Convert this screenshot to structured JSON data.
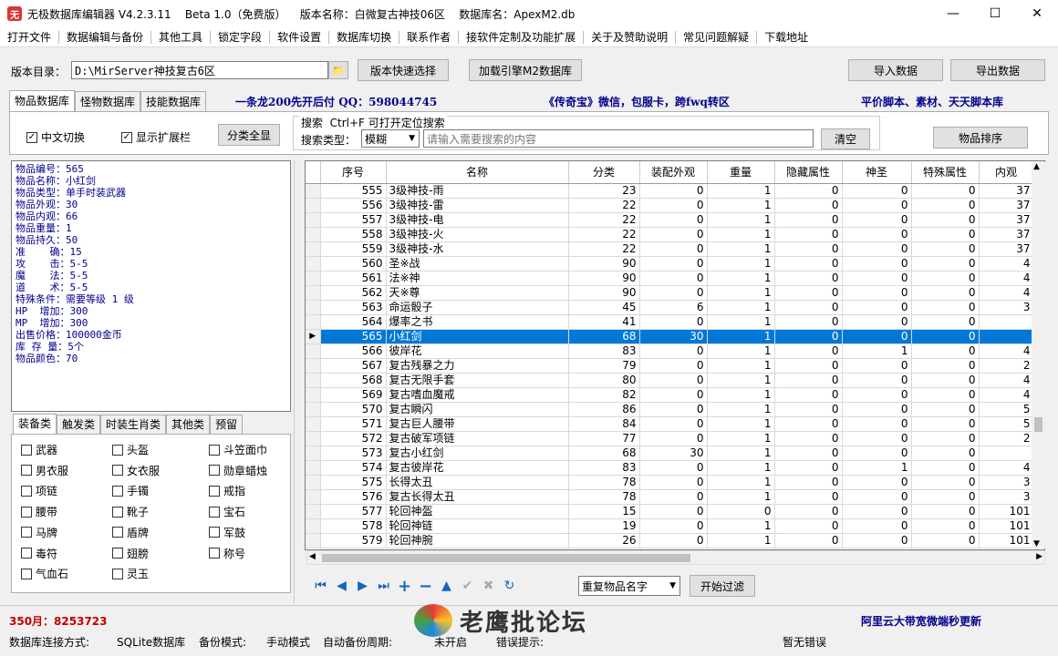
{
  "window": {
    "title": "无极数据库编辑器 V4.2.3.11    Beta 1.0（免费版）    版本名称：白微复古神技06区    数据库名：ApexM2.db",
    "minimize": "—",
    "maximize": "☐",
    "close": "✕"
  },
  "menu": [
    "打开文件",
    "数据编辑与备份",
    "其他工具",
    "锁定字段",
    "软件设置",
    "数据库切换",
    "联系作者",
    "接软件定制及功能扩展",
    "关于及赞助说明",
    "常见问题解疑",
    "下载地址"
  ],
  "toolbar": {
    "dir_label": "版本目录：",
    "dir_value": "D:\\MirServer神技复古6区",
    "quick_select": "版本快速选择",
    "load_engine": "加载引擎M2数据库",
    "import": "导入数据",
    "export": "导出数据"
  },
  "db_tabs": [
    "物品数据库",
    "怪物数据库",
    "技能数据库"
  ],
  "banners": {
    "b1": "一条龙200先开后付 QQ：598044745",
    "b2": "《传奇宝》微信，包服卡，跨fwq转区",
    "b3": "平价脚本、素材、天天脚本库"
  },
  "options": {
    "chinese_switch": "中文切换",
    "show_ext": "显示扩展栏",
    "show_all": "分类全显",
    "search_title": "搜索  Ctrl+F 可打开定位搜索",
    "search_type_label": "搜索类型：",
    "search_type_value": "模糊",
    "search_placeholder": "请输入需要搜索的内容",
    "clear": "清空",
    "sort": "物品排序"
  },
  "item_info": [
    "物品编号：565",
    "物品名称：小红剑",
    "物品类型：单手时装武器",
    "物品外观：30",
    "物品内观：66",
    "物品重量：1",
    "物品持久：50",
    "准    确：15",
    "攻    击：5-5",
    "魔    法：5-5",
    "道    术：5-5",
    "特殊条件：需要等级 1 级",
    "HP  增加：300",
    "MP  增加：300",
    "出售价格：100000金币",
    "库 存 量：5个",
    "物品颜色：70"
  ],
  "cat_tabs": [
    "装备类",
    "触发类",
    "时装生肖类",
    "其他类",
    "预留"
  ],
  "categories": [
    "武器",
    "头盔",
    "斗笠面巾",
    "男衣服",
    "女衣服",
    "勋章蜡烛",
    "项链",
    "手镯",
    "戒指",
    "腰带",
    "靴子",
    "宝石",
    "马牌",
    "盾牌",
    "军鼓",
    "毒符",
    "翅膀",
    "称号",
    "气血石",
    "灵玉"
  ],
  "table": {
    "headers": [
      "序号",
      "名称",
      "分类",
      "装配外观",
      "重量",
      "隐藏属性",
      "神圣",
      "特殊属性",
      "内观"
    ],
    "rows": [
      [
        "555",
        "3级神技-雨",
        "23",
        "0",
        "1",
        "0",
        "0",
        "0",
        "37"
      ],
      [
        "556",
        "3级神技-雷",
        "22",
        "0",
        "1",
        "0",
        "0",
        "0",
        "37"
      ],
      [
        "557",
        "3级神技-电",
        "22",
        "0",
        "1",
        "0",
        "0",
        "0",
        "37"
      ],
      [
        "558",
        "3级神技-火",
        "22",
        "0",
        "1",
        "0",
        "0",
        "0",
        "37"
      ],
      [
        "559",
        "3级神技-水",
        "22",
        "0",
        "1",
        "0",
        "0",
        "0",
        "37"
      ],
      [
        "560",
        "圣※战",
        "90",
        "0",
        "1",
        "0",
        "0",
        "0",
        "4"
      ],
      [
        "561",
        "法※神",
        "90",
        "0",
        "1",
        "0",
        "0",
        "0",
        "4"
      ],
      [
        "562",
        "天※尊",
        "90",
        "0",
        "1",
        "0",
        "0",
        "0",
        "4"
      ],
      [
        "563",
        "命运骰子",
        "45",
        "6",
        "1",
        "0",
        "0",
        "0",
        "3"
      ],
      [
        "564",
        "爆率之书",
        "41",
        "0",
        "1",
        "0",
        "0",
        "0",
        ""
      ],
      [
        "565",
        "小红剑",
        "68",
        "30",
        "1",
        "0",
        "0",
        "0",
        ""
      ],
      [
        "566",
        "彼岸花",
        "83",
        "0",
        "1",
        "0",
        "1",
        "0",
        "4"
      ],
      [
        "567",
        "复古残暴之力",
        "79",
        "0",
        "1",
        "0",
        "0",
        "0",
        "2"
      ],
      [
        "568",
        "复古无限手套",
        "80",
        "0",
        "1",
        "0",
        "0",
        "0",
        "4"
      ],
      [
        "569",
        "复古嗜血魔戒",
        "82",
        "0",
        "1",
        "0",
        "0",
        "0",
        "4"
      ],
      [
        "570",
        "复古瞬闪",
        "86",
        "0",
        "1",
        "0",
        "0",
        "0",
        "5"
      ],
      [
        "571",
        "复古巨人腰带",
        "84",
        "0",
        "1",
        "0",
        "0",
        "0",
        "5"
      ],
      [
        "572",
        "复古破军项链",
        "77",
        "0",
        "1",
        "0",
        "0",
        "0",
        "2"
      ],
      [
        "573",
        "复古小红剑",
        "68",
        "30",
        "1",
        "0",
        "0",
        "0",
        ""
      ],
      [
        "574",
        "复古彼岸花",
        "83",
        "0",
        "1",
        "0",
        "1",
        "0",
        "4"
      ],
      [
        "575",
        "长得太丑",
        "78",
        "0",
        "1",
        "0",
        "0",
        "0",
        "3"
      ],
      [
        "576",
        "复古长得太丑",
        "78",
        "0",
        "1",
        "0",
        "0",
        "0",
        "3"
      ],
      [
        "577",
        "轮回神盔",
        "15",
        "0",
        "0",
        "0",
        "0",
        "0",
        "101"
      ],
      [
        "578",
        "轮回神链",
        "19",
        "0",
        "1",
        "0",
        "0",
        "0",
        "101"
      ],
      [
        "579",
        "轮回神腕",
        "26",
        "0",
        "1",
        "0",
        "0",
        "0",
        "101"
      ]
    ],
    "selected_index": 10
  },
  "nav": {
    "filter_type": "重复物品名字",
    "start_filter": "开始过滤"
  },
  "footer": {
    "qq": "350月：8253723",
    "watermark": "老鹰批论坛",
    "ad": "阿里云大带宽微端秒更新"
  },
  "statusbar": {
    "conn_label": "数据库连接方式:",
    "conn_value": "SQLite数据库",
    "backup_label": "备份模式:",
    "backup_value": "手动模式",
    "auto_label": "自动备份周期:",
    "auto_value": "未开启",
    "err_label": "错误提示:",
    "err_value": "暂无错误"
  },
  "colors": {
    "selection": "#0078d7",
    "banner": "#00008b",
    "footer_red": "#c00000"
  }
}
